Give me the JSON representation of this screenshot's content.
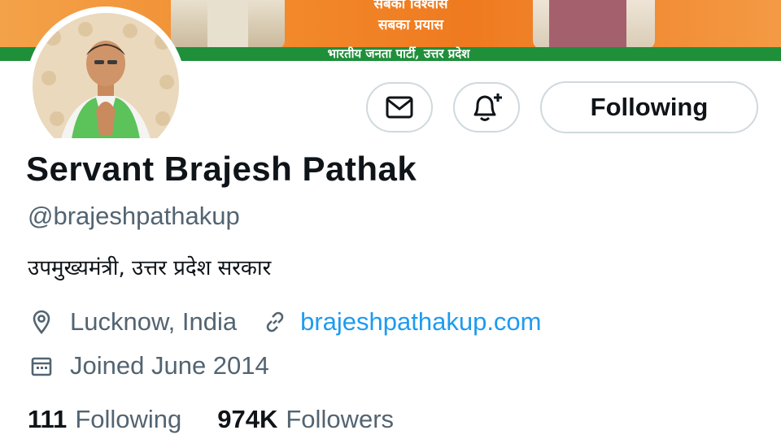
{
  "banner": {
    "slogan_line_1": "सबका विश्वास",
    "slogan_line_2": "सबका प्रयास",
    "party_line": "भारतीय जनता पार्टी, उत्तर प्रदेश",
    "colors": {
      "saffron": "#ef7a1f",
      "green": "#1f8f3a"
    }
  },
  "profile": {
    "display_name": "Servant Brajesh Pathak",
    "handle": "@brajeshpathakup",
    "bio": "उपमुख्यमंत्री, उत्तर प्रदेश सरकार",
    "location": "Lucknow, India",
    "website": "brajeshpathakup.com",
    "joined": "Joined June 2014"
  },
  "actions": {
    "message_icon": "envelope-icon",
    "notify_icon": "bell-plus-icon",
    "follow_label": "Following"
  },
  "stats": {
    "following_count": "111",
    "following_label": "Following",
    "followers_count": "974K",
    "followers_label": "Followers"
  },
  "icons": {
    "location": "location-pin-icon",
    "link": "link-icon",
    "calendar": "calendar-icon"
  },
  "colors": {
    "text_primary": "#0f1419",
    "text_secondary": "#536471",
    "link": "#1d9bf0",
    "button_border": "#cfd9de"
  }
}
